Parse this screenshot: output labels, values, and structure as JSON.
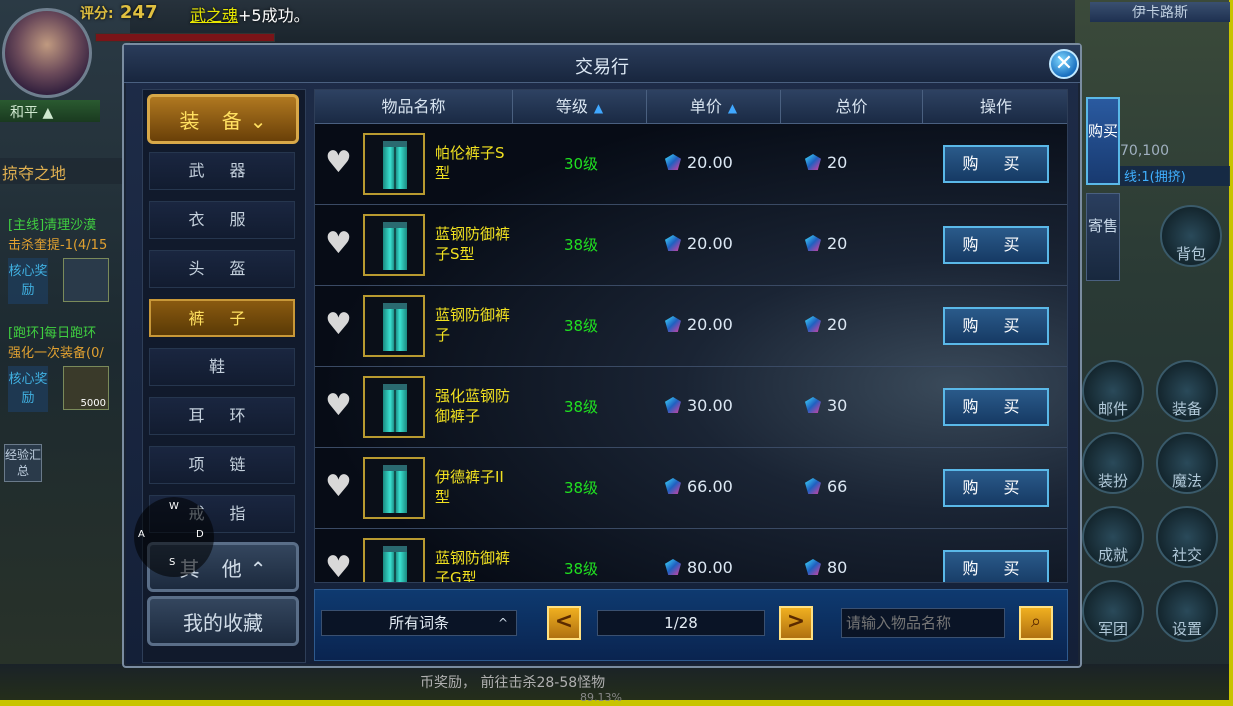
{
  "hud": {
    "score_label": "评分:",
    "score_value": "247",
    "notice_name": "武之魂",
    "notice_text": "+5成功。",
    "stance": "和平",
    "zone": "掠夺之地",
    "quest1_title": "[主线]清理沙漠",
    "quest1_detail": "击杀奎提-1(4/15",
    "reward_label": "核心奖励",
    "quest2_title": "[跑环]每日跑环",
    "quest2_detail": "强化一次装备(0/",
    "reward2_amount": "5000",
    "exp_button": "经验汇总",
    "map_name": "伊卡路斯",
    "coords": "70,100",
    "channel": "线:1(拥挤)",
    "right_buttons": [
      "背包",
      "邮件",
      "装备",
      "装扮",
      "魔法",
      "成就",
      "社交",
      "军团",
      "设置"
    ],
    "bottom_text": "币奖励， 前往击杀28-58怪物",
    "exp_percent": "89.13%"
  },
  "trade": {
    "title": "交易行",
    "close_label": "✕",
    "categories": {
      "equip_label": "装 备",
      "equip_arrow": "⌄",
      "subs": [
        "武 器",
        "衣 服",
        "头 盔",
        "裤 子",
        "鞋",
        "耳 环",
        "项 链",
        "戒 指"
      ],
      "active_index": 3,
      "other_label": "其 他",
      "other_arrow": "⌃",
      "favorites_label": "我的收藏"
    },
    "dpad": {
      "up": "W",
      "left": "A",
      "right": "D",
      "down": "S"
    },
    "headers": {
      "name": "物品名称",
      "level": "等级",
      "unit_price": "单价",
      "total_price": "总价",
      "action": "操作"
    },
    "rows": [
      {
        "name": "帕伦裤子S型",
        "level": "30级",
        "unit_price": "20.00",
        "total_price": "20",
        "buy": "购 买"
      },
      {
        "name": "蓝钢防御裤子S型",
        "level": "38级",
        "unit_price": "20.00",
        "total_price": "20",
        "buy": "购 买"
      },
      {
        "name": "蓝钢防御裤子",
        "level": "38级",
        "unit_price": "20.00",
        "total_price": "20",
        "buy": "购 买"
      },
      {
        "name": "强化蓝钢防御裤子",
        "level": "38级",
        "unit_price": "30.00",
        "total_price": "30",
        "buy": "购 买"
      },
      {
        "name": "伊德裤子II型",
        "level": "38级",
        "unit_price": "66.00",
        "total_price": "66",
        "buy": "购 买"
      },
      {
        "name": "蓝钢防御裤子G型",
        "level": "38级",
        "unit_price": "80.00",
        "total_price": "80",
        "buy": "购 买"
      }
    ],
    "filter": {
      "label": "所有词条",
      "arrow": "^"
    },
    "pagination": {
      "prev": "<",
      "next": ">",
      "indicator": "1/28"
    },
    "search": {
      "placeholder": "请输入物品名称",
      "button_icon": "search-icon"
    },
    "side_tabs": [
      "购买",
      "寄售"
    ]
  }
}
